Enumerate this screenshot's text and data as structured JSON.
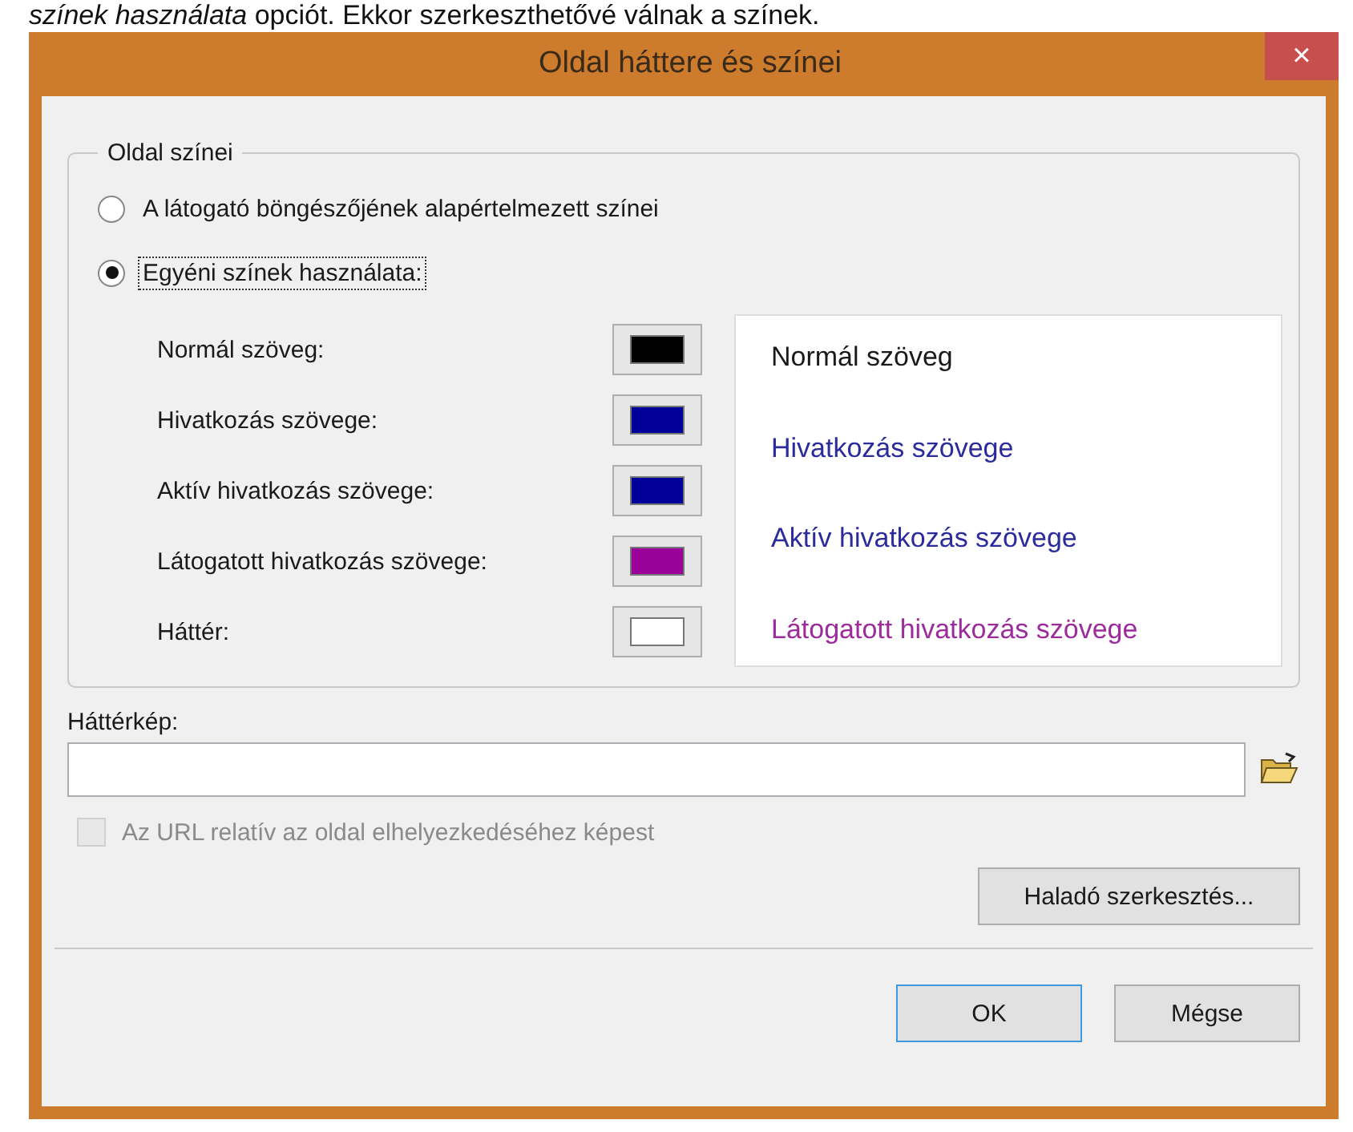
{
  "caption": "*színek használata* opciót. Ekkor szerkeszthetővé válnak a színek.",
  "window": {
    "title": "Oldal háttere és színei",
    "close": "×"
  },
  "colors_group": {
    "title": "Oldal színei",
    "options": [
      {
        "label": "A látogató böngészőjének alapértelmezett színei",
        "selected": false,
        "focused": false
      },
      {
        "label": "Egyéni színek használata:",
        "selected": true,
        "focused": true
      }
    ],
    "color_rows": [
      {
        "label": "Normál szöveg:",
        "color": "#000000"
      },
      {
        "label": "Hivatkozás szövege:",
        "color": "#000099"
      },
      {
        "label": "Aktív hivatkozás szövege:",
        "color": "#000099"
      },
      {
        "label": "Látogatott hivatkozás szövege:",
        "color": "#990099"
      },
      {
        "label": "Háttér:",
        "color": "#ffffff"
      }
    ],
    "preview": [
      {
        "text": "Normál szöveg",
        "color": "#1a1a1a"
      },
      {
        "text": "Hivatkozás szövege",
        "color": "#2b2b9c"
      },
      {
        "text": "Aktív hivatkozás szövege",
        "color": "#2b2b9c"
      },
      {
        "text": "Látogatott hivatkozás szövege",
        "color": "#9c2b9c"
      }
    ]
  },
  "background_image": {
    "label": "Háttérkép:"
  },
  "relative_checkbox": {
    "label": "Az URL relatív az oldal elhelyezkedéséhez képest",
    "checked": false,
    "disabled": true
  },
  "advanced_button": "Haladó szerkesztés...",
  "buttons": [
    {
      "label": "OK",
      "default": true
    },
    {
      "label": "Mégse",
      "default": false
    }
  ]
}
